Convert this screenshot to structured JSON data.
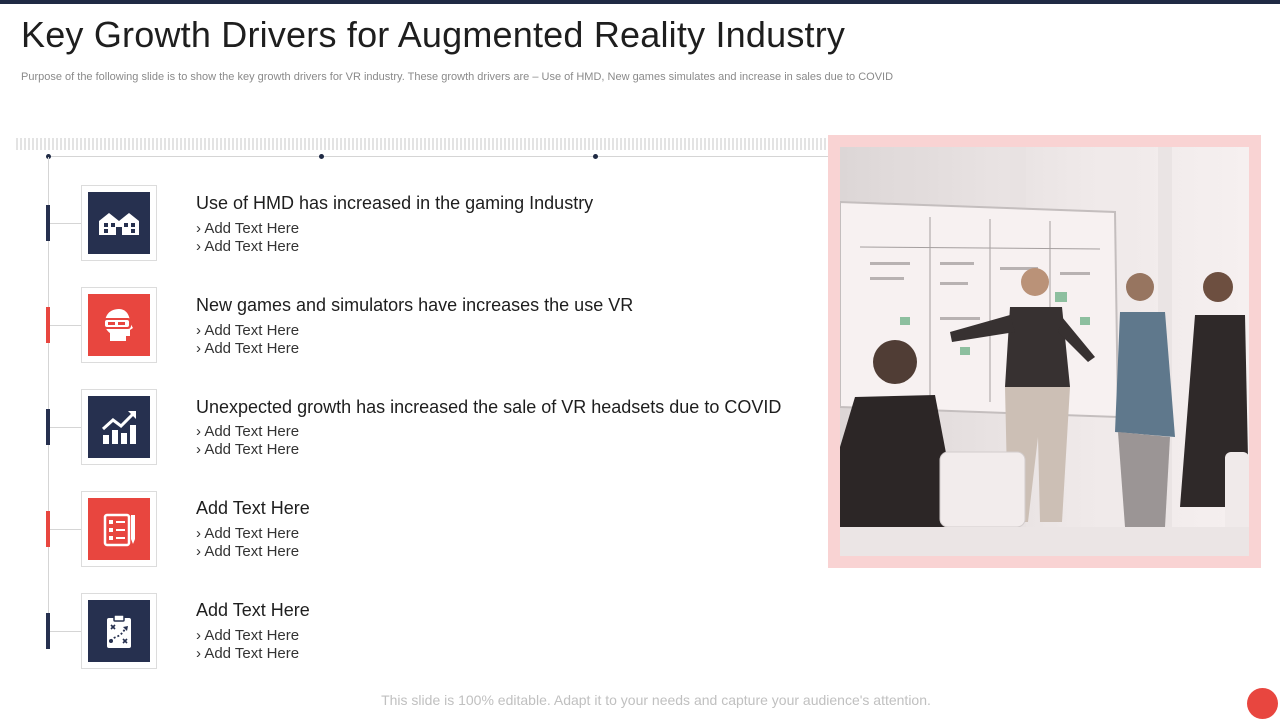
{
  "slide": {
    "title": "Key Growth Drivers for Augmented Reality Industry",
    "subtitle": "Purpose of the following slide is to show the key growth drivers for VR industry. These growth drivers are – Use of HMD, New games simulates and increase in sales due to COVID",
    "footer": "This slide is 100% editable. Adapt it to your needs and capture your audience's attention."
  },
  "colors": {
    "navy": "#26304f",
    "red": "#e8463f",
    "pink_frame": "#f9d3d3"
  },
  "drivers": [
    {
      "title": "Use of HMD has increased in the gaming Industry",
      "icon": "buildings-icon",
      "color": "navy",
      "bullets": [
        "› Add Text Here",
        "› Add Text Here"
      ]
    },
    {
      "title": "New games and simulators have increases the use VR",
      "icon": "vr-headset-head-icon",
      "color": "red",
      "bullets": [
        "› Add Text Here",
        "› Add Text Here"
      ]
    },
    {
      "title": "Unexpected growth has increased the sale of VR headsets due to COVID",
      "icon": "growth-chart-icon",
      "color": "navy",
      "bullets": [
        "› Add Text Here",
        "› Add Text Here"
      ]
    },
    {
      "title": "Add Text Here",
      "icon": "checklist-pen-icon",
      "color": "red",
      "bullets": [
        "› Add Text Here",
        "› Add Text Here"
      ]
    },
    {
      "title": "Add Text Here",
      "icon": "clipboard-strategy-icon",
      "color": "navy",
      "bullets": [
        "› Add Text Here",
        "› Add Text Here"
      ]
    }
  ],
  "image": {
    "icon": "team-meeting-photo"
  }
}
